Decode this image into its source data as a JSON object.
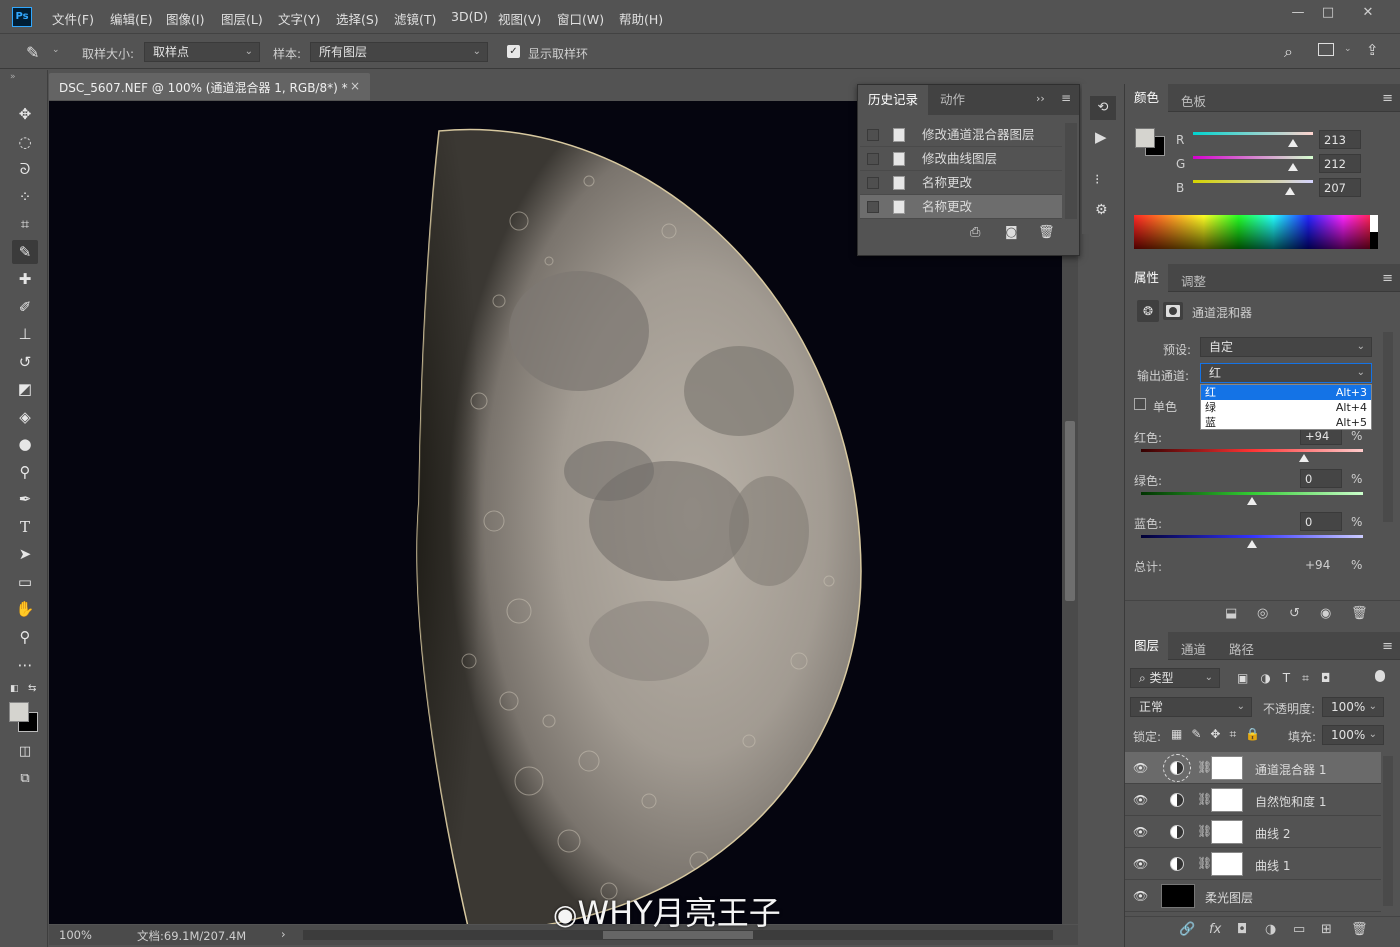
{
  "app": {
    "logo": "Ps"
  },
  "menu": [
    "文件(F)",
    "编辑(E)",
    "图像(I)",
    "图层(L)",
    "文字(Y)",
    "选择(S)",
    "滤镜(T)",
    "3D(D)",
    "视图(V)",
    "窗口(W)",
    "帮助(H)"
  ],
  "window_controls": {
    "minimize": "—",
    "maximize": "□",
    "close": "✕"
  },
  "options": {
    "sample_size_label": "取样大小:",
    "sample_size_value": "取样点",
    "sample_label": "样本:",
    "sample_value": "所有图层",
    "show_ring_label": "显示取样环",
    "show_ring_checked": true
  },
  "document": {
    "tab_title": "DSC_5607.NEF @ 100% (通道混合器 1, RGB/8*) *",
    "close": "×"
  },
  "status": {
    "zoom": "100%",
    "doc_info": "文档:69.1M/207.4M",
    "arrow": "›"
  },
  "history": {
    "tabs": [
      "历史记录",
      "动作"
    ],
    "items": [
      "修改通道混合器图层",
      "修改曲线图层",
      "名称更改",
      "名称更改"
    ],
    "selected_index": 3
  },
  "color_panel": {
    "tabs": [
      "颜色",
      "色板"
    ],
    "r_label": "R",
    "g_label": "G",
    "b_label": "B",
    "r": "213",
    "g": "212",
    "b": "207",
    "r_level": 0.835,
    "g_level": 0.831,
    "b_level": 0.812
  },
  "properties": {
    "tabs": [
      "属性",
      "调整"
    ],
    "title": "通道混和器",
    "preset_label": "预设:",
    "preset_value": "自定",
    "output_label": "输出通道:",
    "output_value": "红",
    "dropdown": [
      {
        "name": "红",
        "shortcut": "Alt+3"
      },
      {
        "name": "绿",
        "shortcut": "Alt+4"
      },
      {
        "name": "蓝",
        "shortcut": "Alt+5"
      }
    ],
    "mono_label": "单色",
    "red_label": "红色:",
    "red_value": "+94",
    "red_level": 0.735,
    "green_label": "绿色:",
    "green_value": "0",
    "green_level": 0.5,
    "blue_label": "蓝色:",
    "blue_value": "0",
    "blue_level": 0.5,
    "pct": "%",
    "total_label": "总计:",
    "total_value": "+94"
  },
  "layers": {
    "tabs": [
      "图层",
      "通道",
      "路径"
    ],
    "filter_label": "类型",
    "blend_mode": "正常",
    "opacity_label": "不透明度:",
    "opacity": "100%",
    "lock_label": "锁定:",
    "fill_label": "填充:",
    "fill": "100%",
    "items": [
      {
        "name": "通道混合器 1",
        "type": "adjustment",
        "selected": true
      },
      {
        "name": "自然饱和度 1",
        "type": "adjustment",
        "selected": false
      },
      {
        "name": "曲线 2",
        "type": "adjustment",
        "selected": false
      },
      {
        "name": "曲线 1",
        "type": "adjustment",
        "selected": false
      },
      {
        "name": "柔光图层",
        "type": "pixel",
        "selected": false
      }
    ],
    "footer": [
      "🔗",
      "fx",
      "◘",
      "◑",
      "▭",
      "⊞",
      "🗑"
    ]
  },
  "watermark": "WHY月亮王子",
  "colors": {
    "accent": "#31a8ff",
    "select_blue": "#1473e6",
    "panel": "#535353",
    "canvas": "#05050f"
  }
}
